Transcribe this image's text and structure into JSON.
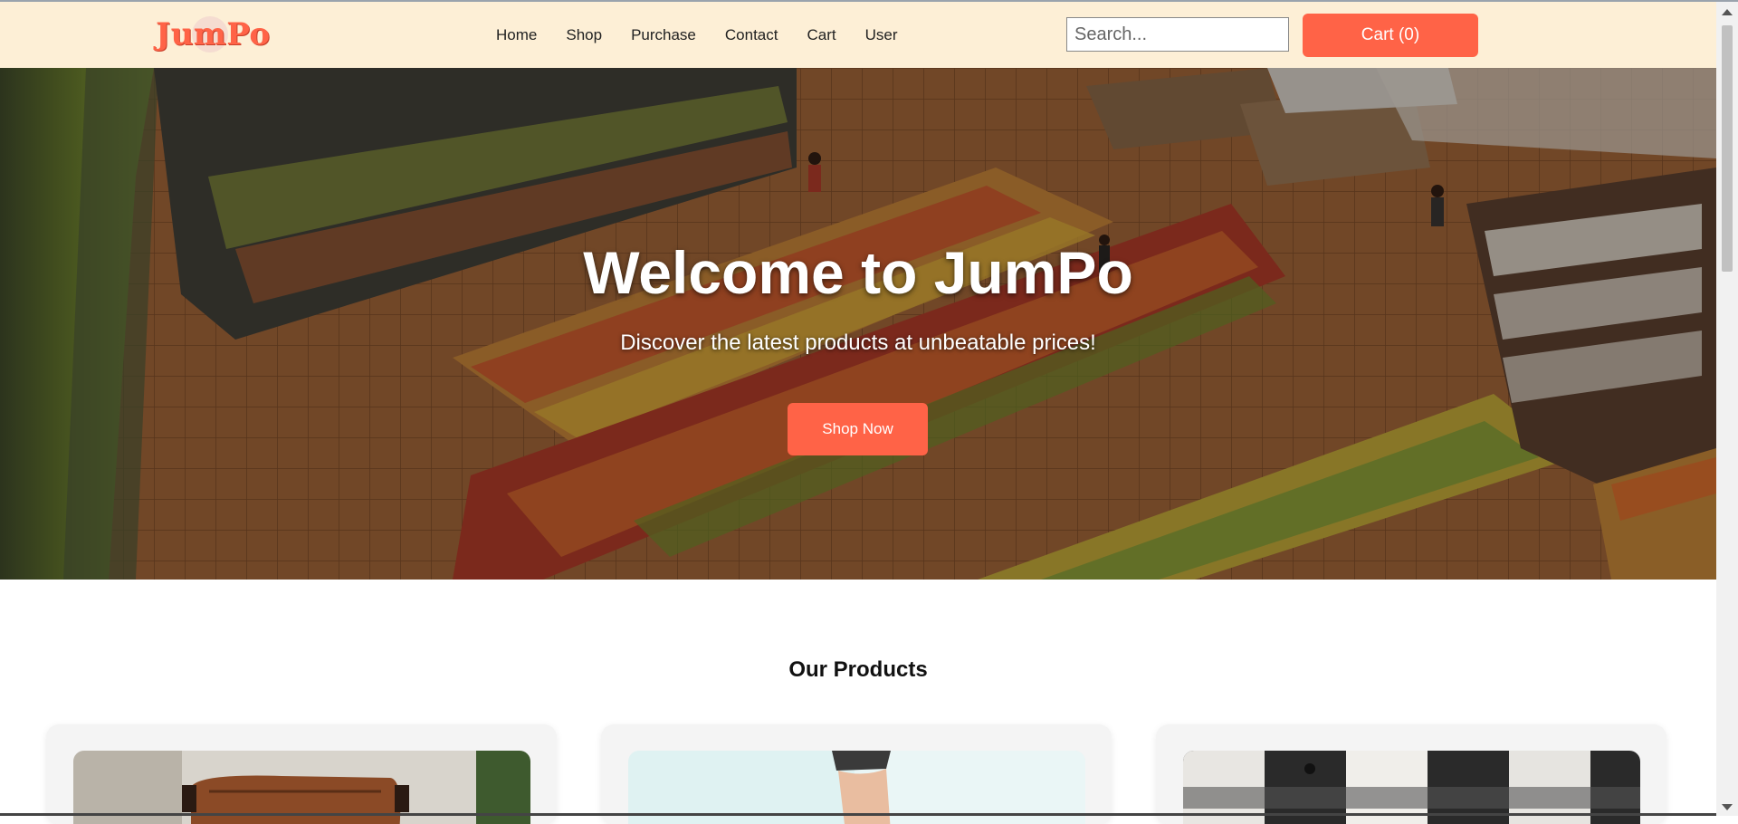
{
  "brand": {
    "logo_text": "JumPo",
    "accent": "#ff6347",
    "nav_bg": "#fdefd6"
  },
  "nav": {
    "links": [
      "Home",
      "Shop",
      "Purchase",
      "Contact",
      "Cart",
      "User"
    ],
    "search_placeholder": "Search...",
    "cart_button": "Cart (0)"
  },
  "hero": {
    "title": "Welcome to JumPo",
    "subtitle": "Discover the latest products at unbeatable prices!",
    "cta": "Shop Now"
  },
  "products": {
    "heading": "Our Products"
  }
}
